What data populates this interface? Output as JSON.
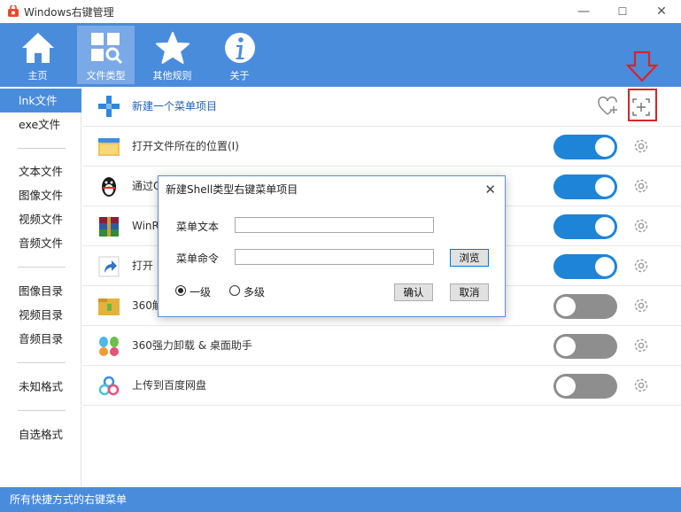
{
  "window": {
    "title": "Windows右键管理",
    "minimize": "—",
    "maximize": "☐",
    "close": "✕"
  },
  "toolbar": {
    "home_label": "主页",
    "filetype_label": "文件类型",
    "other_label": "其他规则",
    "about_label": "关于"
  },
  "sidebar": {
    "items": [
      "lnk文件",
      "exe文件",
      "文本文件",
      "图像文件",
      "视频文件",
      "音频文件",
      "图像目录",
      "视频目录",
      "音频目录",
      "未知格式",
      "自选格式"
    ]
  },
  "main": {
    "new_item_label": "新建一个菜单项目",
    "rows": [
      {
        "label": "打开文件所在的位置(I)",
        "enabled": true
      },
      {
        "label": "通过QQ发送到",
        "enabled": true
      },
      {
        "label": "WinRAR",
        "enabled": true
      },
      {
        "label": "打开",
        "enabled": true
      },
      {
        "label": "360解压",
        "enabled": false
      },
      {
        "label": "360强力卸载 & 桌面助手",
        "enabled": false
      },
      {
        "label": "上传到百度网盘",
        "enabled": false
      }
    ]
  },
  "dialog": {
    "title": "新建Shell类型右键菜单项目",
    "close": "✕",
    "text_label": "菜单文本",
    "text_value": "",
    "command_label": "菜单命令",
    "command_value": "",
    "browse": "浏览",
    "level1": "一级",
    "multilevel": "多级",
    "ok": "确认",
    "cancel": "取消"
  },
  "status": {
    "text": "所有快捷方式的右键菜单"
  },
  "colors": {
    "accent": "#4a8cdc",
    "toggle_on": "#1e84d8",
    "toggle_off": "#8e8e8e",
    "annotation": "#d9232b"
  }
}
